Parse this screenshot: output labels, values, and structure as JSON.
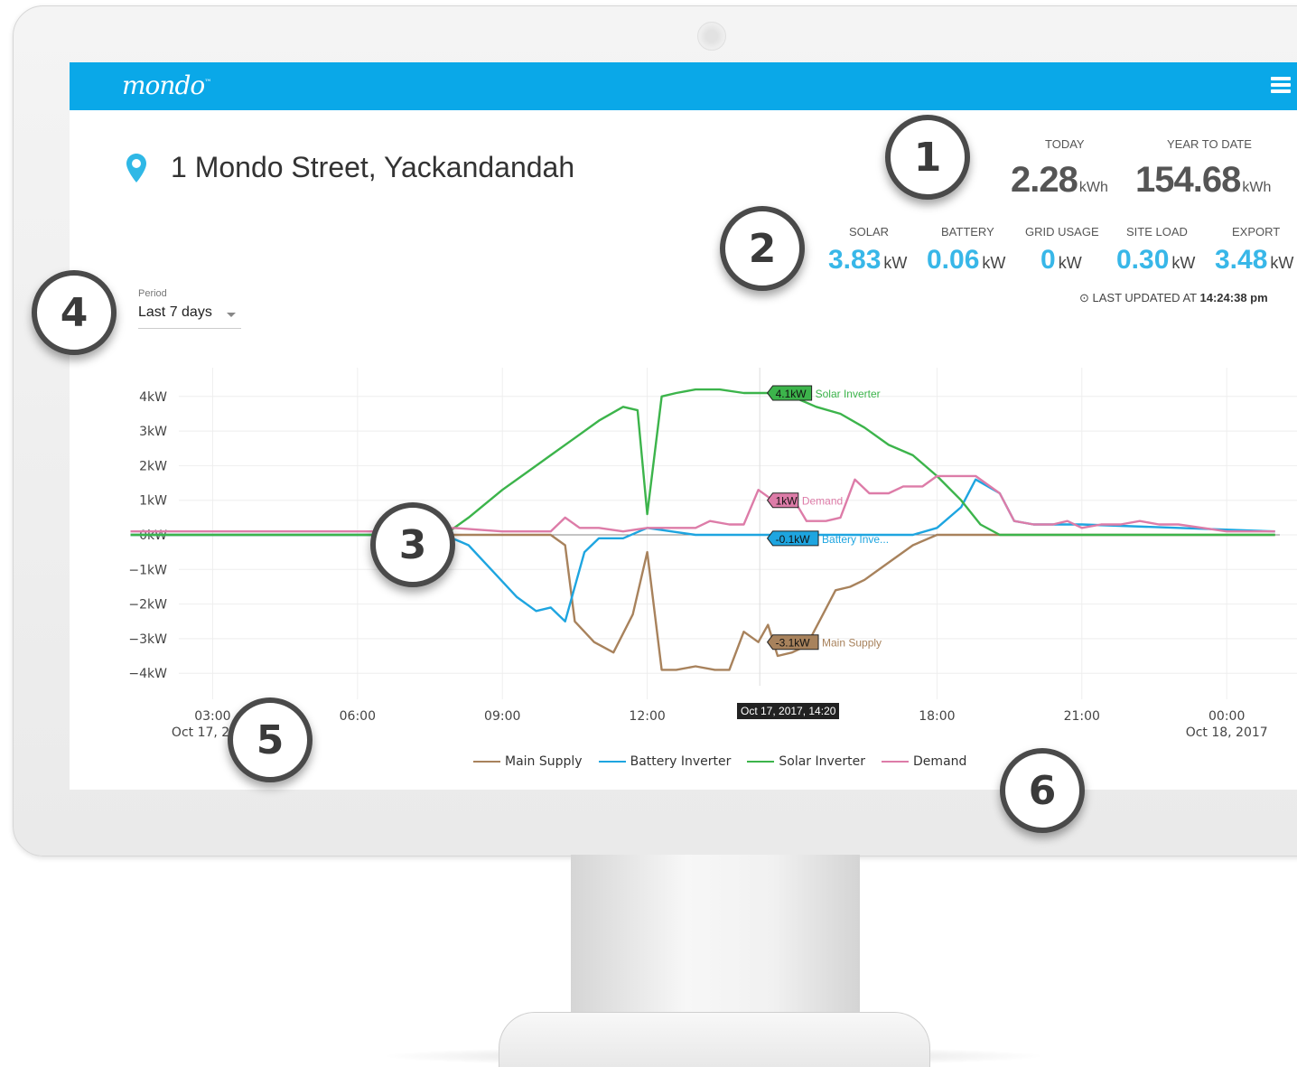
{
  "app": {
    "logo": "mondo",
    "logo_tm": "™"
  },
  "address": "1 Mondo Street, Yackandandah",
  "energy": {
    "today_label": "TODAY",
    "today_value": "2.28",
    "today_unit": "kWh",
    "ytd_label": "YEAR TO DATE",
    "ytd_value": "154.68",
    "ytd_unit": "kWh"
  },
  "metrics": [
    {
      "label": "SOLAR",
      "value": "3.83",
      "unit": "kW"
    },
    {
      "label": "BATTERY",
      "value": "0.06",
      "unit": "kW"
    },
    {
      "label": "GRID USAGE",
      "value": "0",
      "unit": "kW"
    },
    {
      "label": "SITE LOAD",
      "value": "0.30",
      "unit": "kW"
    },
    {
      "label": "EXPORT",
      "value": "3.48",
      "unit": "kW"
    }
  ],
  "last_updated": {
    "label": "LAST UPDATED AT",
    "time": "14:24:38 pm"
  },
  "period": {
    "label": "Period",
    "value": "Last 7 days"
  },
  "tooltip_time": "Oct 17, 2017, 14:20",
  "callouts": [
    "1",
    "2",
    "3",
    "4",
    "5",
    "6"
  ],
  "colors": {
    "main": "#a8825c",
    "battery": "#1ea5e0",
    "solar": "#3cb44b",
    "demand": "#dd7ca8",
    "overlap": "#9b59a6",
    "header": "#0aa8e8"
  },
  "chart_data": {
    "type": "line",
    "y_ticks": [
      "4kW",
      "3kW",
      "2kW",
      "1kW",
      "0kW",
      "−1kW",
      "−2kW",
      "−3kW",
      "−4kW"
    ],
    "ylim": [
      -4.3,
      4.3
    ],
    "x_ticks": [
      {
        "t": 3,
        "l1": "03:00",
        "l2": "Oct 17, 2017"
      },
      {
        "t": 6,
        "l1": "06:00",
        "l2": ""
      },
      {
        "t": 9,
        "l1": "09:00",
        "l2": ""
      },
      {
        "t": 12,
        "l1": "12:00",
        "l2": ""
      },
      {
        "t": 18,
        "l1": "18:00",
        "l2": ""
      },
      {
        "t": 21,
        "l1": "21:00",
        "l2": ""
      },
      {
        "t": 24,
        "l1": "00:00",
        "l2": "Oct 18, 2017"
      }
    ],
    "xlim": [
      2.3,
      25.1
    ],
    "series": [
      {
        "key": "main",
        "name": "Main Supply",
        "color": "#a8825c",
        "points": [
          [
            1.3,
            0
          ],
          [
            7.8,
            0
          ],
          [
            8,
            0
          ],
          [
            9,
            0
          ],
          [
            10,
            0
          ],
          [
            10.3,
            -0.3
          ],
          [
            10.5,
            -2.5
          ],
          [
            10.9,
            -3.1
          ],
          [
            11.3,
            -3.4
          ],
          [
            11.7,
            -2.3
          ],
          [
            12,
            -0.5
          ],
          [
            12.3,
            -3.9
          ],
          [
            12.6,
            -3.9
          ],
          [
            13,
            -3.8
          ],
          [
            13.4,
            -3.9
          ],
          [
            13.7,
            -3.9
          ],
          [
            14,
            -2.8
          ],
          [
            14.3,
            -3.1
          ],
          [
            14.5,
            -2.6
          ],
          [
            14.7,
            -3.5
          ],
          [
            15,
            -3.4
          ],
          [
            15.3,
            -3.2
          ],
          [
            15.6,
            -2.4
          ],
          [
            15.9,
            -1.6
          ],
          [
            16.2,
            -1.5
          ],
          [
            16.5,
            -1.3
          ],
          [
            17,
            -0.8
          ],
          [
            17.5,
            -0.3
          ],
          [
            18,
            0
          ],
          [
            18.5,
            0
          ],
          [
            25,
            0
          ]
        ],
        "label": "-3.1kW",
        "label_text": "Main Supply",
        "label_t": 14.6,
        "label_y": -3.1
      },
      {
        "key": "battery",
        "name": "Battery Inverter",
        "color": "#1ea5e0",
        "points": [
          [
            1.3,
            0
          ],
          [
            7.8,
            0
          ],
          [
            8.3,
            -0.3
          ],
          [
            9.3,
            -1.8
          ],
          [
            9.7,
            -2.2
          ],
          [
            10,
            -2.1
          ],
          [
            10.3,
            -2.5
          ],
          [
            10.7,
            -0.5
          ],
          [
            11,
            -0.1
          ],
          [
            11.5,
            -0.1
          ],
          [
            12,
            0.2
          ],
          [
            12.5,
            0.1
          ],
          [
            13,
            0
          ],
          [
            14.5,
            0
          ],
          [
            15,
            0
          ],
          [
            17,
            0
          ],
          [
            17.5,
            0
          ],
          [
            18,
            0.2
          ],
          [
            18.5,
            0.8
          ],
          [
            18.8,
            1.6
          ],
          [
            19.3,
            1.2
          ],
          [
            19.6,
            0.4
          ],
          [
            20,
            0.3
          ],
          [
            21,
            0.3
          ],
          [
            25,
            0.1
          ]
        ],
        "label": "-0.1kW",
        "label_text": "Battery Inve...",
        "label_t": 14.6,
        "label_y": -0.1
      },
      {
        "key": "solar",
        "name": "Solar Inverter",
        "color": "#3cb44b",
        "points": [
          [
            1.3,
            0
          ],
          [
            7.8,
            0
          ],
          [
            8.3,
            0.5
          ],
          [
            9,
            1.3
          ],
          [
            9.5,
            1.8
          ],
          [
            10,
            2.3
          ],
          [
            10.5,
            2.8
          ],
          [
            11,
            3.3
          ],
          [
            11.5,
            3.7
          ],
          [
            11.8,
            3.6
          ],
          [
            12,
            0.6
          ],
          [
            12.3,
            4
          ],
          [
            12.6,
            4.1
          ],
          [
            13,
            4.2
          ],
          [
            13.5,
            4.2
          ],
          [
            14,
            4.1
          ],
          [
            14.5,
            4.1
          ],
          [
            15,
            4
          ],
          [
            15.5,
            3.7
          ],
          [
            16,
            3.5
          ],
          [
            16.5,
            3.1
          ],
          [
            17,
            2.6
          ],
          [
            17.5,
            2.3
          ],
          [
            18,
            1.7
          ],
          [
            18.5,
            1
          ],
          [
            18.9,
            0.3
          ],
          [
            19.3,
            0
          ],
          [
            20,
            0
          ],
          [
            25,
            0
          ]
        ],
        "label": "4.1kW",
        "label_text": "Solar Inverter",
        "label_t": 14.6,
        "label_y": 4.1
      },
      {
        "key": "demand",
        "name": "Demand",
        "color": "#dd7ca8",
        "points": [
          [
            1.3,
            0.1
          ],
          [
            7.5,
            0.1
          ],
          [
            8,
            0.2
          ],
          [
            8.5,
            0.15
          ],
          [
            9,
            0.1
          ],
          [
            9.5,
            0.1
          ],
          [
            10,
            0.1
          ],
          [
            10.3,
            0.5
          ],
          [
            10.6,
            0.2
          ],
          [
            11,
            0.2
          ],
          [
            11.5,
            0.1
          ],
          [
            12,
            0.2
          ],
          [
            12.5,
            0.2
          ],
          [
            13,
            0.2
          ],
          [
            13.3,
            0.4
          ],
          [
            13.7,
            0.3
          ],
          [
            14,
            0.3
          ],
          [
            14.3,
            1.3
          ],
          [
            14.6,
            1
          ],
          [
            15,
            1.1
          ],
          [
            15.3,
            0.4
          ],
          [
            15.7,
            0.4
          ],
          [
            16,
            0.5
          ],
          [
            16.3,
            1.6
          ],
          [
            16.6,
            1.2
          ],
          [
            17,
            1.2
          ],
          [
            17.3,
            1.4
          ],
          [
            17.7,
            1.4
          ],
          [
            18,
            1.7
          ],
          [
            18.5,
            1.7
          ],
          [
            18.8,
            1.7
          ],
          [
            19.3,
            1.2
          ],
          [
            19.6,
            0.4
          ],
          [
            20,
            0.3
          ],
          [
            20.4,
            0.3
          ],
          [
            20.7,
            0.4
          ],
          [
            21,
            0.2
          ],
          [
            21.4,
            0.3
          ],
          [
            21.8,
            0.3
          ],
          [
            22.2,
            0.4
          ],
          [
            22.6,
            0.3
          ],
          [
            23,
            0.3
          ],
          [
            23.5,
            0.2
          ],
          [
            24,
            0.1
          ],
          [
            25,
            0.1
          ]
        ],
        "label": "1kW",
        "label_text": "Demand",
        "label_t": 14.6,
        "label_y": 1
      }
    ]
  }
}
